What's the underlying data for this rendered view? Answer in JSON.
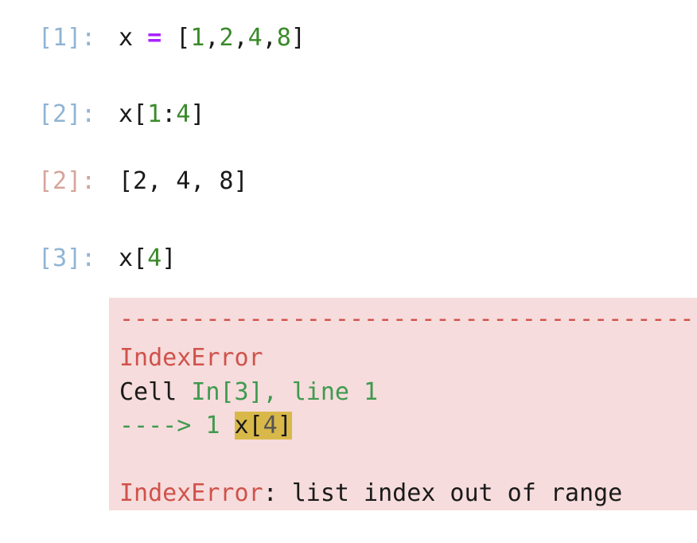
{
  "cells": [
    {
      "prompt": "[1]:",
      "code": {
        "var": "x",
        "op": "=",
        "open": "[",
        "v1": "1",
        "c1": ",",
        "v2": "2",
        "c2": ",",
        "v3": "4",
        "c3": ",",
        "v4": "8",
        "close": "]"
      }
    },
    {
      "prompt": "[2]:",
      "code": {
        "var": "x[",
        "start": "1",
        "colon": ":",
        "end": "4",
        "close": "]"
      },
      "output_prompt": "[2]:",
      "output": "[2, 4, 8]"
    },
    {
      "prompt": "[3]:",
      "code": {
        "var": "x[",
        "idx": "4",
        "close": "]"
      }
    }
  ],
  "error": {
    "dashes": "---------------------------------------------------------------",
    "name": "IndexError",
    "cell_prefix": "Cell ",
    "cell_ref": "In[3], line 1",
    "arrow": "----> 1 ",
    "hl_var": "x[",
    "hl_idx": "4",
    "hl_close": "]",
    "message_name": "IndexError",
    "message_text": ": list index out of range"
  },
  "colors": {
    "in_prompt": "#90b4d4",
    "out_prompt": "#d6a59b",
    "number": "#3a8a2a",
    "operator": "#aa22ff",
    "error_bg": "#f6dcdc",
    "error_red": "#d0524b",
    "error_green": "#3f9a4f",
    "highlight": "#d9b84a"
  }
}
